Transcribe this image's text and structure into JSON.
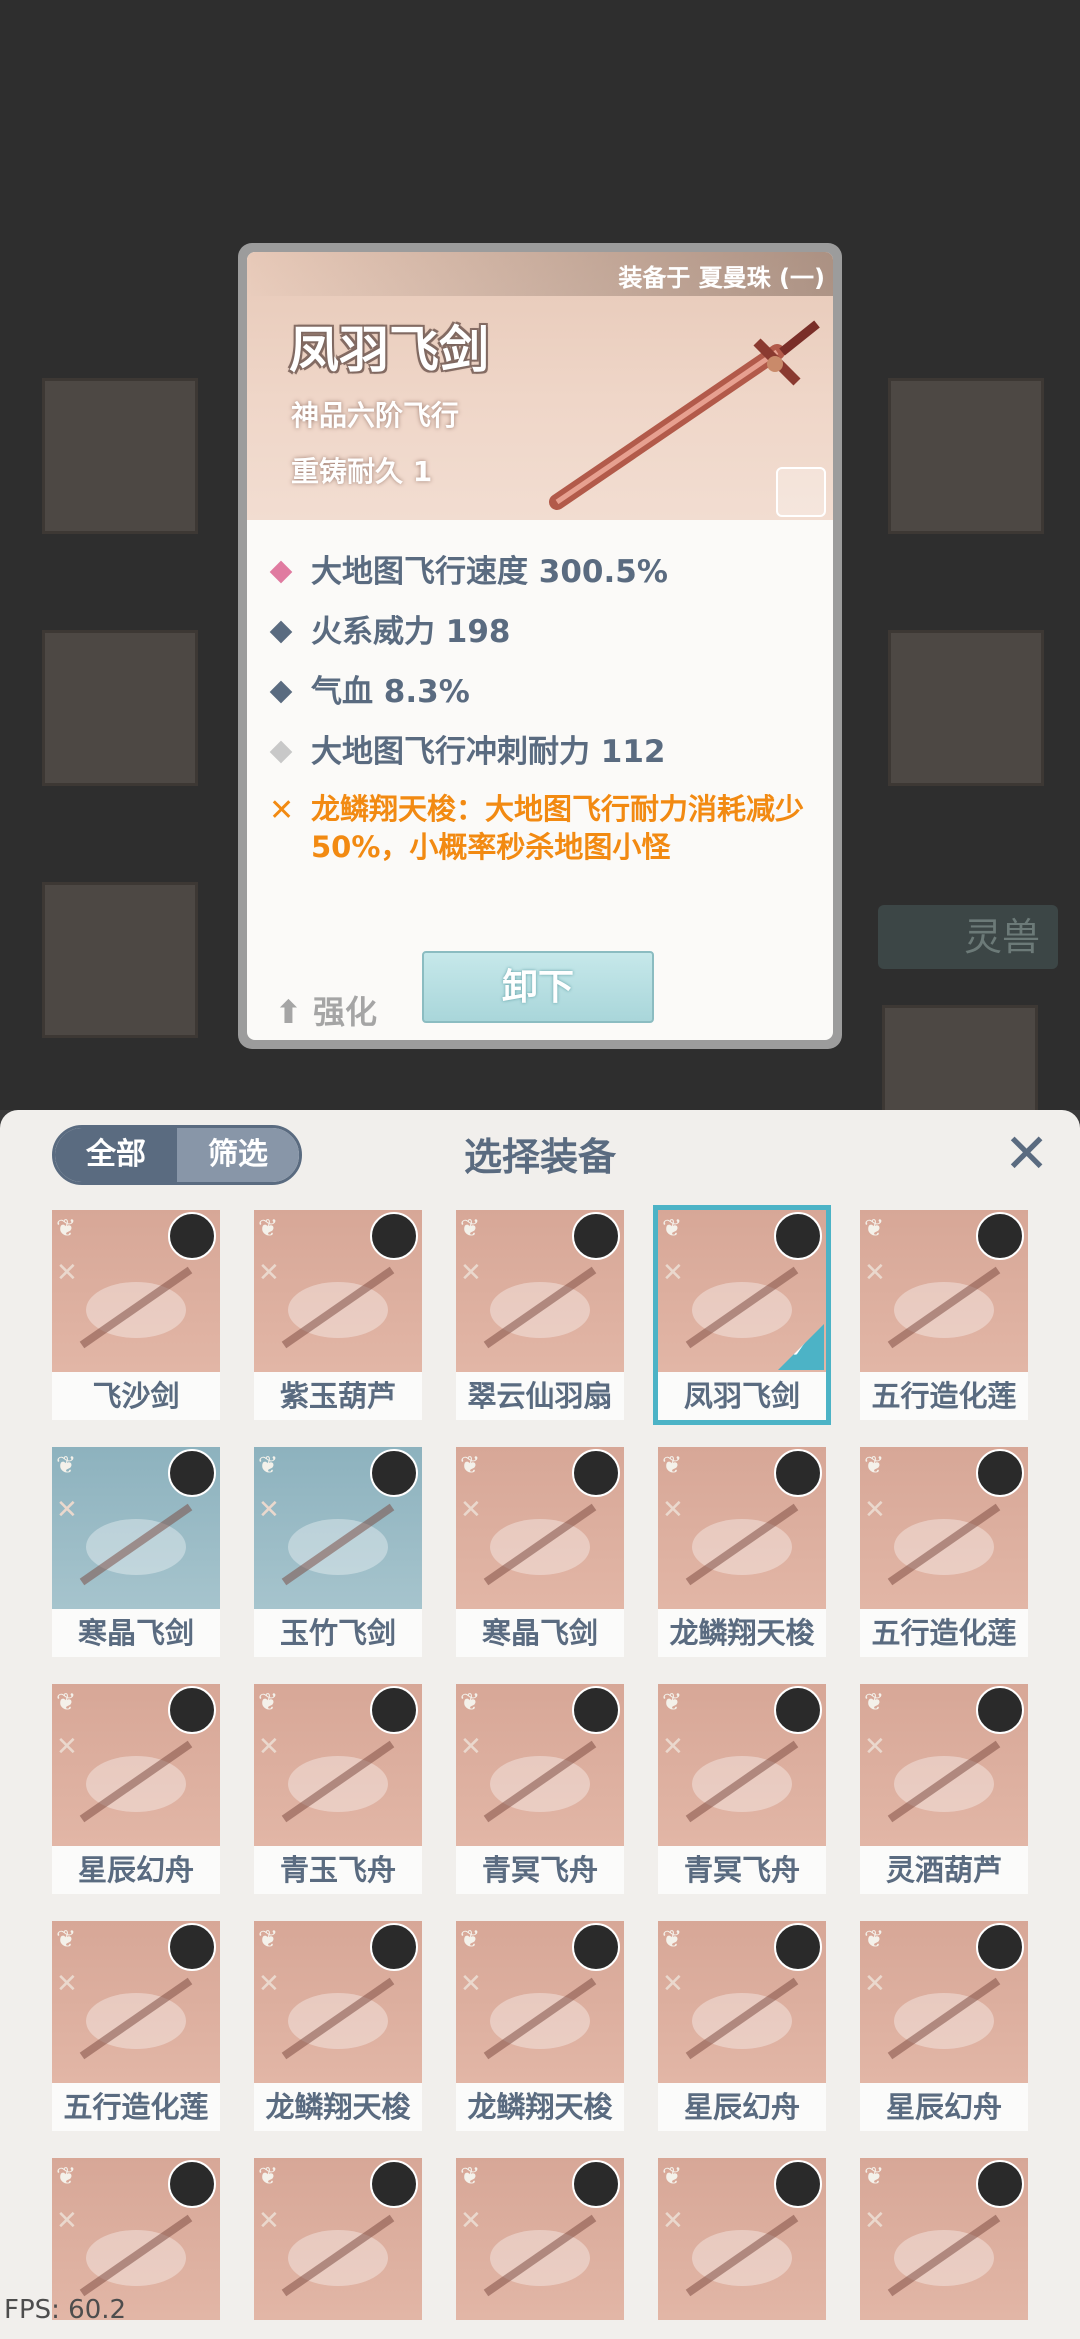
{
  "detail": {
    "equipped_by": "装备于 夏曼珠 (一)",
    "name": "凤羽飞剑",
    "grade": "神品六阶飞行",
    "durability": "重铸耐久 1",
    "stats": [
      {
        "text": "大地图飞行速度 300.5%",
        "color": "#e07ba0"
      },
      {
        "text": "火系威力 198",
        "color": "#5a6b80"
      },
      {
        "text": "气血 8.3%",
        "color": "#5a6b80"
      },
      {
        "text": "大地图飞行冲刺耐力 112",
        "color": "#c8c8c8"
      }
    ],
    "special": "龙鳞翔天梭：大地图飞行耐力消耗减少50%，小概率秒杀地图小怪",
    "enhance_label": "强化",
    "unequip_label": "卸下"
  },
  "background": {
    "tag_label": "灵兽"
  },
  "panel": {
    "tab_all": "全部",
    "tab_filter": "筛选",
    "title": "选择装备",
    "close_icon": "close-icon"
  },
  "items": [
    {
      "name": "飞沙剑",
      "blue": false
    },
    {
      "name": "紫玉葫芦",
      "blue": false
    },
    {
      "name": "翠云仙羽扇",
      "blue": false
    },
    {
      "name": "凤羽飞剑",
      "blue": false,
      "selected": true
    },
    {
      "name": "五行造化莲",
      "blue": false
    },
    {
      "name": "寒晶飞剑",
      "blue": true
    },
    {
      "name": "玉竹飞剑",
      "blue": true
    },
    {
      "name": "寒晶飞剑",
      "blue": false
    },
    {
      "name": "龙鳞翔天梭",
      "blue": false
    },
    {
      "name": "五行造化莲",
      "blue": false
    },
    {
      "name": "星辰幻舟",
      "blue": false
    },
    {
      "name": "青玉飞舟",
      "blue": false
    },
    {
      "name": "青冥飞舟",
      "blue": false
    },
    {
      "name": "青冥飞舟",
      "blue": false
    },
    {
      "name": "灵酒葫芦",
      "blue": false
    },
    {
      "name": "五行造化莲",
      "blue": false
    },
    {
      "name": "龙鳞翔天梭",
      "blue": false
    },
    {
      "name": "龙鳞翔天梭",
      "blue": false
    },
    {
      "name": "星辰幻舟",
      "blue": false
    },
    {
      "name": "星辰幻舟",
      "blue": false
    },
    {
      "name": "",
      "blue": false
    },
    {
      "name": "",
      "blue": false
    },
    {
      "name": "",
      "blue": false
    },
    {
      "name": "",
      "blue": false
    },
    {
      "name": "",
      "blue": false
    }
  ],
  "fps": "FPS: 60.2"
}
